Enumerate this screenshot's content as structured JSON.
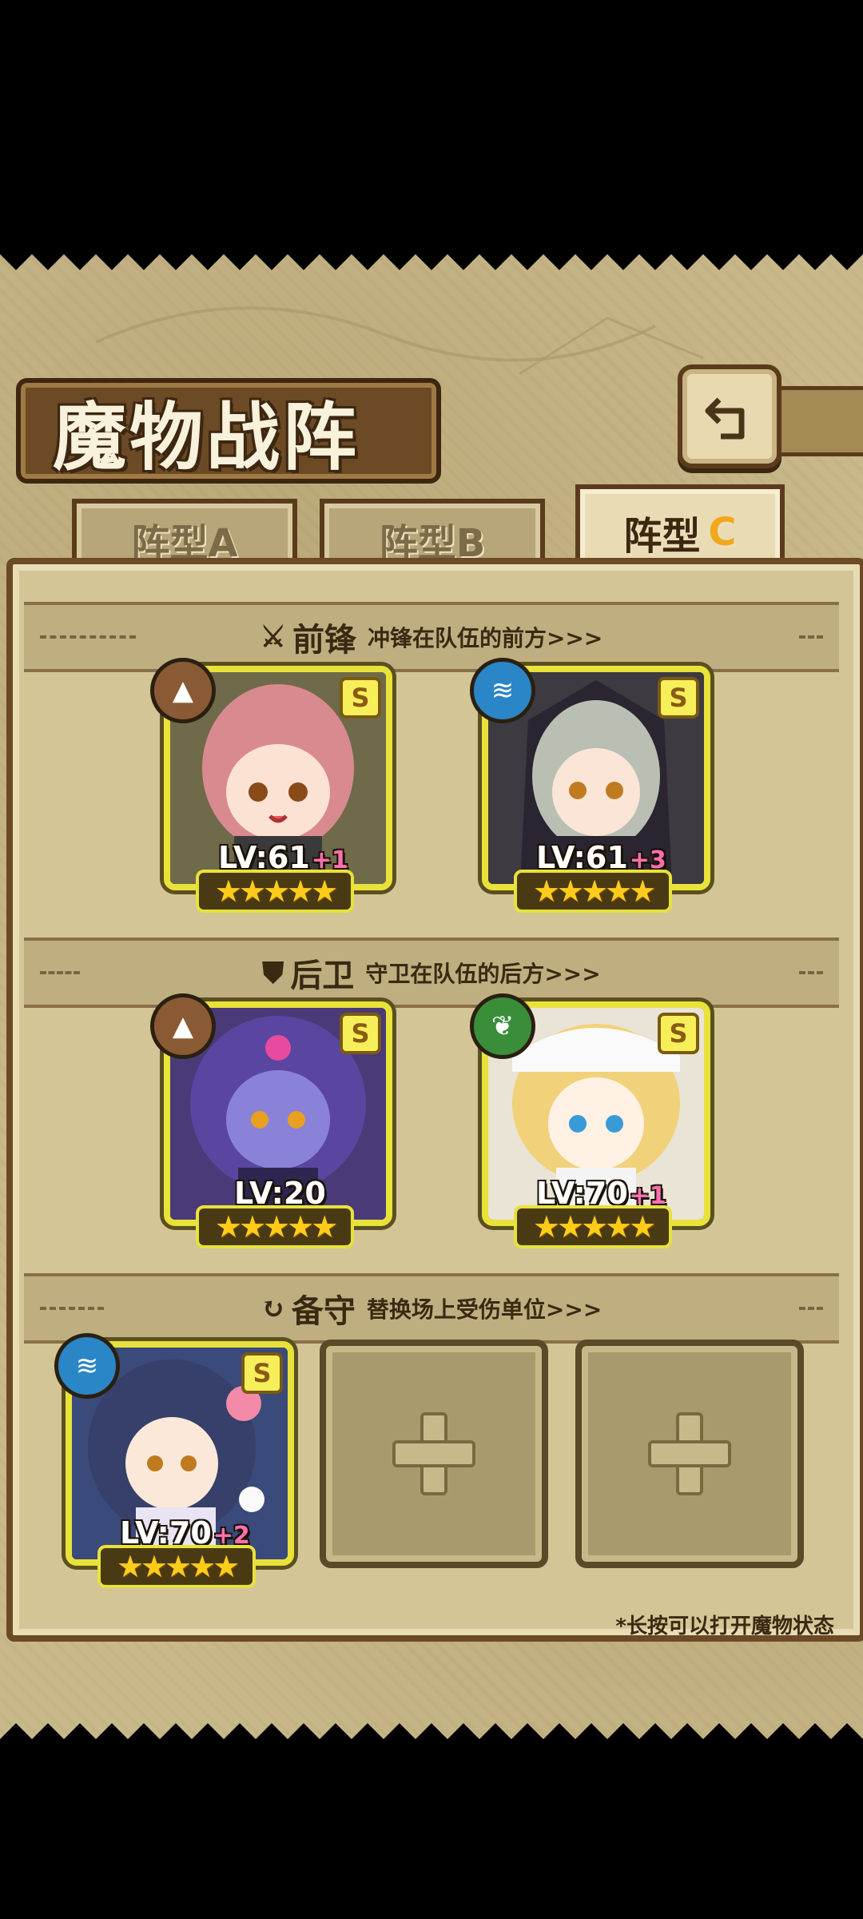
{
  "title": "魔物战阵",
  "tabs": [
    {
      "label": "阵型A",
      "active": false
    },
    {
      "label": "阵型B",
      "active": false
    },
    {
      "label": "阵型",
      "accent": "C",
      "active": true
    }
  ],
  "sections": {
    "front": {
      "title": "前锋",
      "desc": "冲锋在队伍的前方>>>"
    },
    "rear": {
      "title": "后卫",
      "desc": "守卫在队伍的后方>>>"
    },
    "reserve": {
      "title": "备守",
      "desc": "替换场上受伤单位>>>"
    }
  },
  "units": [
    {
      "element": "rock",
      "rank": "S",
      "lv": "LV:61",
      "bonus": "+1",
      "stars": "★★★★★"
    },
    {
      "element": "water",
      "rank": "S",
      "lv": "LV:61",
      "bonus": "+3",
      "stars": "★★★★★"
    },
    {
      "element": "rock",
      "rank": "S",
      "lv": "LV:20",
      "bonus": "",
      "stars": "★★★★★"
    },
    {
      "element": "leaf",
      "rank": "S",
      "lv": "LV:70",
      "bonus": "+1",
      "stars": "★★★★★"
    },
    {
      "element": "water",
      "rank": "S",
      "lv": "LV:70",
      "bonus": "+2",
      "stars": "★★★★★"
    }
  ],
  "empty_slots": 2,
  "footnote": "*长按可以打开魔物状态",
  "colors": {
    "accent": "#f2a81c",
    "card_border": "#e8e23a",
    "bonus": "#ff6fb0"
  }
}
